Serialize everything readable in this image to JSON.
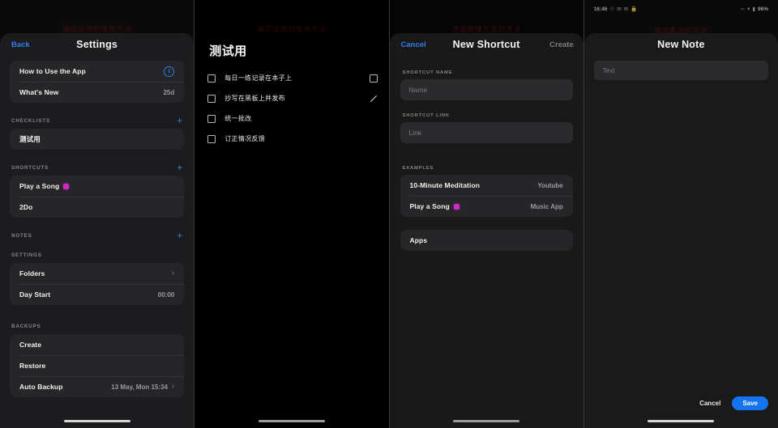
{
  "panels": {
    "settings": {
      "watermark": "捕捉应用的使用方法",
      "nav": {
        "back": "Back",
        "title": "Settings"
      },
      "help_card": [
        {
          "label": "How to Use the App",
          "value": "",
          "icon": "info-circle-icon"
        },
        {
          "label": "What's New",
          "value": "25d",
          "icon": ""
        }
      ],
      "sections": [
        {
          "title": "CHECKLISTS",
          "add": "+",
          "rows": [
            {
              "label": "测试用",
              "value": ""
            }
          ]
        },
        {
          "title": "SHORTCUTS",
          "add": "+",
          "rows": [
            {
              "label": "Play a Song",
              "value": "",
              "badge": true
            },
            {
              "label": "2Do",
              "value": ""
            }
          ]
        },
        {
          "title": "NOTES",
          "add": "+",
          "rows": []
        },
        {
          "title": "SETTINGS",
          "add": "",
          "rows": [
            {
              "label": "Folders",
              "value": "",
              "chevron": true
            },
            {
              "label": "Day Start",
              "value": "00:00"
            }
          ]
        },
        {
          "title": "BACKUPS",
          "add": "",
          "rows": [
            {
              "label": "Create",
              "value": ""
            },
            {
              "label": "Restore",
              "value": ""
            },
            {
              "label": "Auto Backup",
              "value": "13 May, Mon 15:34",
              "chevron": true
            }
          ]
        }
      ]
    },
    "checklist": {
      "watermark": "编写应用的使用方法",
      "title": "测试用",
      "items": [
        {
          "text": "每日一练记录在本子上",
          "checked": false,
          "trailing": "checkbox"
        },
        {
          "text": "抄写在黑板上并发布",
          "checked": false,
          "trailing": "pencil"
        },
        {
          "text": "统一批改",
          "checked": false,
          "trailing": ""
        },
        {
          "text": "订正情况反馈",
          "checked": false,
          "trailing": ""
        }
      ]
    },
    "new_shortcut": {
      "watermark": "添加快捷方式的方法",
      "nav": {
        "cancel": "Cancel",
        "title": "New Shortcut",
        "create": "Create"
      },
      "fields": [
        {
          "label": "SHORTCUT NAME",
          "placeholder": "Name",
          "value": ""
        },
        {
          "label": "SHORTCUT LINK",
          "placeholder": "Link",
          "value": ""
        }
      ],
      "examples_label": "EXAMPLES",
      "examples": [
        {
          "name": "10-Minute Meditation",
          "source": "Youtube",
          "badge": false
        },
        {
          "name": "Play a Song",
          "source": "Music App",
          "badge": true
        }
      ],
      "apps_label": "Apps"
    },
    "new_note": {
      "watermark": "添加笔记的方法",
      "statusbar": {
        "time": "16:46",
        "left_icons": [
          "location-icon",
          "message-icon",
          "message-icon",
          "lock-icon"
        ],
        "signal": "signal-icon",
        "wifi": "wifi-icon",
        "battery": "battery-icon",
        "battery_level": "96%"
      },
      "nav": {
        "title": "New Note"
      },
      "text_field": {
        "placeholder": "Text",
        "value": ""
      },
      "actions": {
        "cancel": "Cancel",
        "save": "Save"
      }
    }
  },
  "colors": {
    "accent_blue": "#1374f0",
    "link_blue": "#2f7fe8",
    "badge_magenta": "#cc2bc4",
    "sheet_bg": "#1c1c1e",
    "card_bg": "#262628",
    "field_bg": "#2b2b2d",
    "watermark_red": "#5a1016"
  }
}
